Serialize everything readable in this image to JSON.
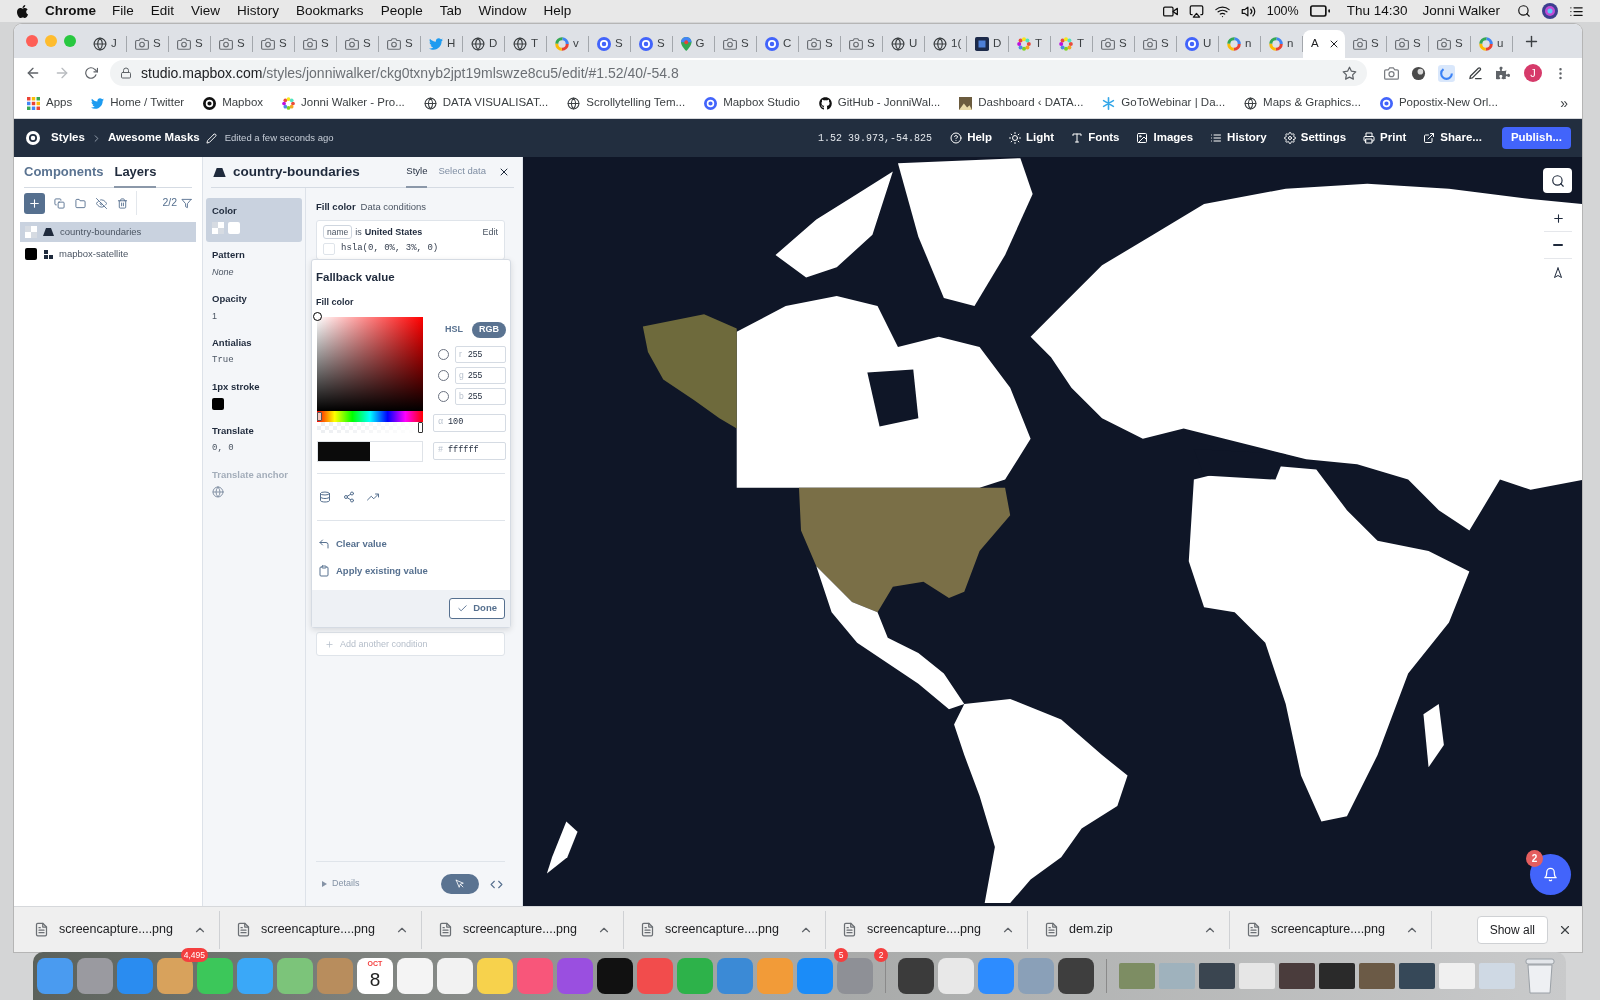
{
  "menu_bar": {
    "app": "Chrome",
    "menus": [
      "File",
      "Edit",
      "View",
      "History",
      "Bookmarks",
      "People",
      "Tab",
      "Window",
      "Help"
    ],
    "battery": "100%",
    "clock": "Thu 14:30",
    "user": "Jonni Walker"
  },
  "browser": {
    "tabs": [
      {
        "label": "J",
        "selected": false
      },
      {
        "label": "S",
        "selected": false
      },
      {
        "label": "S",
        "selected": false
      },
      {
        "label": "S",
        "selected": false
      },
      {
        "label": "S",
        "selected": false
      },
      {
        "label": "S",
        "selected": false
      },
      {
        "label": "S",
        "selected": false
      },
      {
        "label": "S",
        "selected": false
      },
      {
        "label": "H",
        "selected": false
      },
      {
        "label": "D",
        "selected": false
      },
      {
        "label": "T",
        "selected": false
      },
      {
        "label": "v",
        "selected": false
      },
      {
        "label": "S",
        "selected": false
      },
      {
        "label": "S",
        "selected": false
      },
      {
        "label": "G",
        "selected": false
      },
      {
        "label": "S",
        "selected": false
      },
      {
        "label": "C",
        "selected": false
      },
      {
        "label": "S",
        "selected": false
      },
      {
        "label": "S",
        "selected": false
      },
      {
        "label": "U",
        "selected": false
      },
      {
        "label": "1(",
        "selected": false
      },
      {
        "label": "D",
        "selected": false
      },
      {
        "label": "T",
        "selected": false
      },
      {
        "label": "T",
        "selected": false
      },
      {
        "label": "S",
        "selected": false
      },
      {
        "label": "S",
        "selected": false
      },
      {
        "label": "U",
        "selected": false
      },
      {
        "label": "n",
        "selected": false
      },
      {
        "label": "n",
        "selected": false
      },
      {
        "label": "A",
        "selected": true
      },
      {
        "label": "S",
        "selected": false
      },
      {
        "label": "S",
        "selected": false
      },
      {
        "label": "S",
        "selected": false
      },
      {
        "label": "u",
        "selected": false
      }
    ],
    "address": {
      "host": "studio.mapbox.com",
      "path": "/styles/jonniwalker/ckg0txnyb2jpt19mlswze8cu5/edit/#1.52/40/-54.8"
    },
    "profile": "J",
    "bookmarks": [
      "Apps",
      "Home / Twitter",
      "Mapbox",
      "Jonni Walker - Pro...",
      "DATA VISUALISAT...",
      "Scrollytelling Tem...",
      "Mapbox Studio",
      "GitHub - JonniWal...",
      "Dashboard ‹ DATA...",
      "GoToWebinar | Da...",
      "Maps & Graphics...",
      "Popostix-New Orl..."
    ],
    "bookmarks_more": "»"
  },
  "studio_header": {
    "root": "Styles",
    "style_name": "Awesome Masks",
    "status": "Edited a few seconds ago",
    "coordinates": "1.52 39.973,-54.825",
    "actions": [
      "Help",
      "Light",
      "Fonts",
      "Images",
      "History",
      "Settings",
      "Print",
      "Share..."
    ],
    "publish": "Publish..."
  },
  "layers_panel": {
    "tabs": [
      {
        "label": "Components",
        "selected": false
      },
      {
        "label": "Layers",
        "selected": true
      }
    ],
    "count": "2/2",
    "layers": [
      {
        "name": "country-boundaries",
        "kind": "fill",
        "selected": true
      },
      {
        "name": "mapbox-satellite",
        "kind": "raster",
        "selected": false
      }
    ]
  },
  "layer_editor": {
    "title": "country-boundaries",
    "tabs": [
      {
        "label": "Style",
        "selected": true
      },
      {
        "label": "Select data",
        "selected": false
      }
    ],
    "properties": [
      {
        "label": "Color",
        "kind": "swatches",
        "selected": true,
        "disabled": false
      },
      {
        "label": "Pattern",
        "kind": "italic",
        "value": "None",
        "selected": false,
        "disabled": false
      },
      {
        "label": "Opacity",
        "kind": "text",
        "value": "1",
        "selected": false,
        "disabled": false
      },
      {
        "label": "Antialias",
        "kind": "mono",
        "value": "True",
        "selected": false,
        "disabled": false
      },
      {
        "label": "1px stroke",
        "kind": "swatch",
        "selected": false,
        "disabled": false
      },
      {
        "label": "Translate",
        "kind": "mono",
        "value": "0, 0",
        "selected": false,
        "disabled": false
      },
      {
        "label": "Translate anchor",
        "kind": "anchor",
        "selected": false,
        "disabled": true
      }
    ],
    "fill_color": {
      "title": "Fill color",
      "mode": "Data conditions",
      "condition": {
        "field": "name",
        "operator": "is",
        "value": "United States",
        "edit": "Edit",
        "result": "hsla(0, 0%, 3%, 0)"
      },
      "add_condition": "Add another condition"
    },
    "fallback": {
      "title": "Fallback value",
      "label": "Fill color",
      "hue": {
        "level": 0
      },
      "alpha_slider": {
        "level": 1
      },
      "modes": [
        {
          "label": "HSL",
          "selected": false
        },
        {
          "label": "RGB",
          "selected": true
        }
      ],
      "channels": [
        {
          "letter": "r",
          "value": "255",
          "checked": false
        },
        {
          "letter": "g",
          "value": "255",
          "checked": false
        },
        {
          "letter": "b",
          "value": "255",
          "checked": false
        }
      ],
      "alpha": {
        "letter": "α",
        "value": "100"
      },
      "hex": {
        "prefix": "#",
        "value": "ffffff"
      },
      "actions": [
        "Clear value",
        "Apply existing value"
      ],
      "done": "Done"
    },
    "details": "Details"
  },
  "map": {
    "notifications": "2"
  },
  "downloads": {
    "files": [
      "screencapture....png",
      "screencapture....png",
      "screencapture....png",
      "screencapture....png",
      "screencapture....png",
      "dem.zip",
      "screencapture....png"
    ],
    "show_all": "Show all"
  },
  "dock": {
    "items": [
      {
        "kind": "app"
      },
      {
        "kind": "app"
      },
      {
        "kind": "app"
      },
      {
        "kind": "app",
        "badge": "4,495"
      },
      {
        "kind": "app"
      },
      {
        "kind": "app"
      },
      {
        "kind": "app"
      },
      {
        "kind": "app"
      },
      {
        "kind": "calendar",
        "month": "OCT",
        "day": "8"
      },
      {
        "kind": "app"
      },
      {
        "kind": "app"
      },
      {
        "kind": "app"
      },
      {
        "kind": "app"
      },
      {
        "kind": "app"
      },
      {
        "kind": "app"
      },
      {
        "kind": "app"
      },
      {
        "kind": "app"
      },
      {
        "kind": "app"
      },
      {
        "kind": "app"
      },
      {
        "kind": "app",
        "badge": "5"
      },
      {
        "kind": "app",
        "badge": "2"
      },
      {
        "kind": "divider"
      },
      {
        "kind": "app"
      },
      {
        "kind": "app"
      },
      {
        "kind": "app"
      },
      {
        "kind": "app"
      },
      {
        "kind": "app"
      },
      {
        "kind": "divider"
      },
      {
        "kind": "thumbnail"
      },
      {
        "kind": "thumbnail"
      },
      {
        "kind": "thumbnail"
      },
      {
        "kind": "thumbnail"
      },
      {
        "kind": "thumbnail"
      },
      {
        "kind": "thumbnail"
      },
      {
        "kind": "thumbnail"
      },
      {
        "kind": "thumbnail"
      },
      {
        "kind": "thumbnail"
      },
      {
        "kind": "thumbnail"
      },
      {
        "kind": "trash"
      }
    ]
  }
}
